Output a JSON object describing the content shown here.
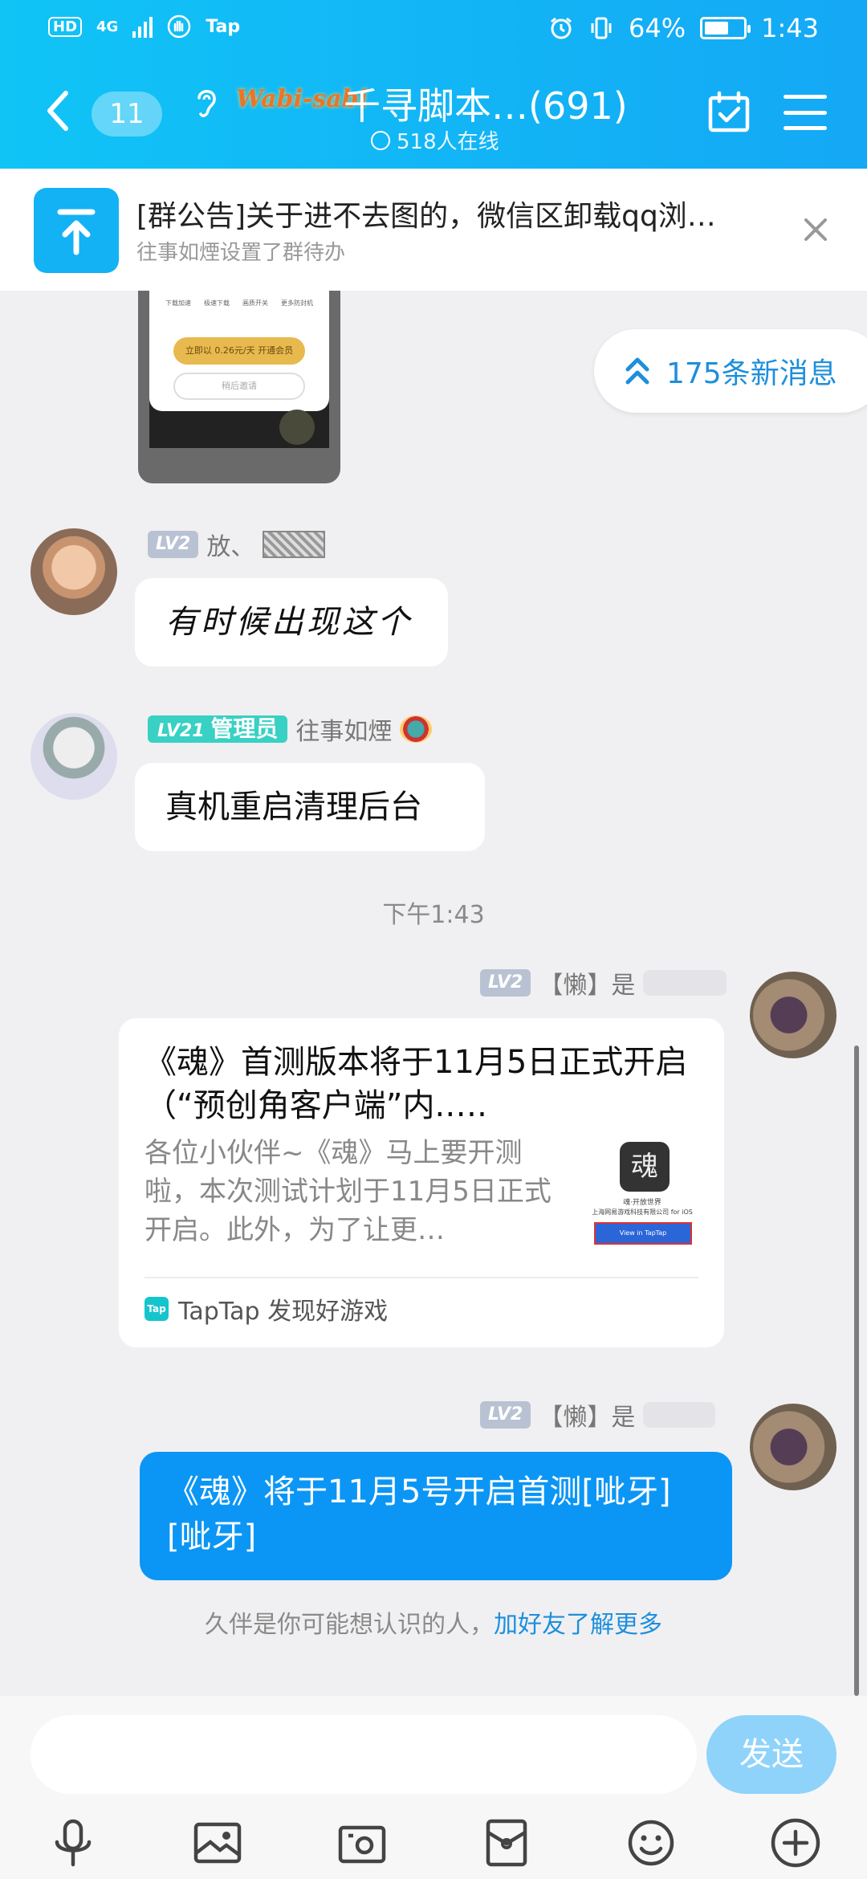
{
  "status_bar": {
    "hd": "HD",
    "network": "4G",
    "app_label": "Tap",
    "battery": "64%",
    "battery_level": 0.64,
    "time": "1:43"
  },
  "header": {
    "unread_count": "11",
    "group_tag": "Wabi-sabi",
    "group_name": "千寻脚本…(691)",
    "online": "518人在线",
    "icons": [
      "back-icon",
      "ear-icon",
      "calendar-check-icon",
      "menu-icon"
    ]
  },
  "notice": {
    "title": "[群公告]关于进不去图的，微信区卸载qq浏…",
    "subtitle": "往事如煙设置了群待办"
  },
  "new_messages": "175条新消息",
  "phone_preview": {
    "tabs": [
      "下载加速",
      "极速下载",
      "画质开关",
      "更多防封机"
    ],
    "primary": "立即以 0.26元/天 开通会员",
    "secondary": "稍后邀请"
  },
  "messages": [
    {
      "level": "LV2",
      "nickname": "放、",
      "text": "有时候出现这个"
    },
    {
      "level": "LV21",
      "role": "管理员",
      "nickname": "往事如煙",
      "text": "真机重启清理后台"
    }
  ],
  "timestamp": "下午1:43",
  "share": {
    "level": "LV2",
    "nickname": "【懒】是",
    "title": "《魂》首测版本将于11月5日正式开启（“预创角客户端”内.….",
    "desc": "各位小伙伴~《魂》马上要开测啦，本次测试计划于11月5日正式开启。此外，为了让更…",
    "source": "TapTap 发现好游戏",
    "source_badge": "Tap",
    "thumb_logo": "魂",
    "thumb_caption": "魂·开放世界",
    "thumb_company": "上海网易游戏科技有限公司 for iOS",
    "thumb_button": "View in TapTap"
  },
  "own_message": {
    "level": "LV2",
    "nickname": "【懒】是",
    "text": "《魂》将于11月5号开启首测[呲牙][呲牙]"
  },
  "tip": {
    "text": "久伴是你可能想认识的人，",
    "link": "加好友了解更多"
  },
  "composer": {
    "placeholder": "",
    "send": "发送",
    "tools": [
      "microphone-icon",
      "image-icon",
      "camera-icon",
      "red-packet-icon",
      "emoji-icon",
      "plus-icon"
    ]
  },
  "colors": {
    "header": "#14b4f5",
    "accent_blue": "#0b96f5",
    "link": "#1d8fdc",
    "admin_badge": "#38d1c4",
    "level_badge": "#b9c2d3"
  }
}
